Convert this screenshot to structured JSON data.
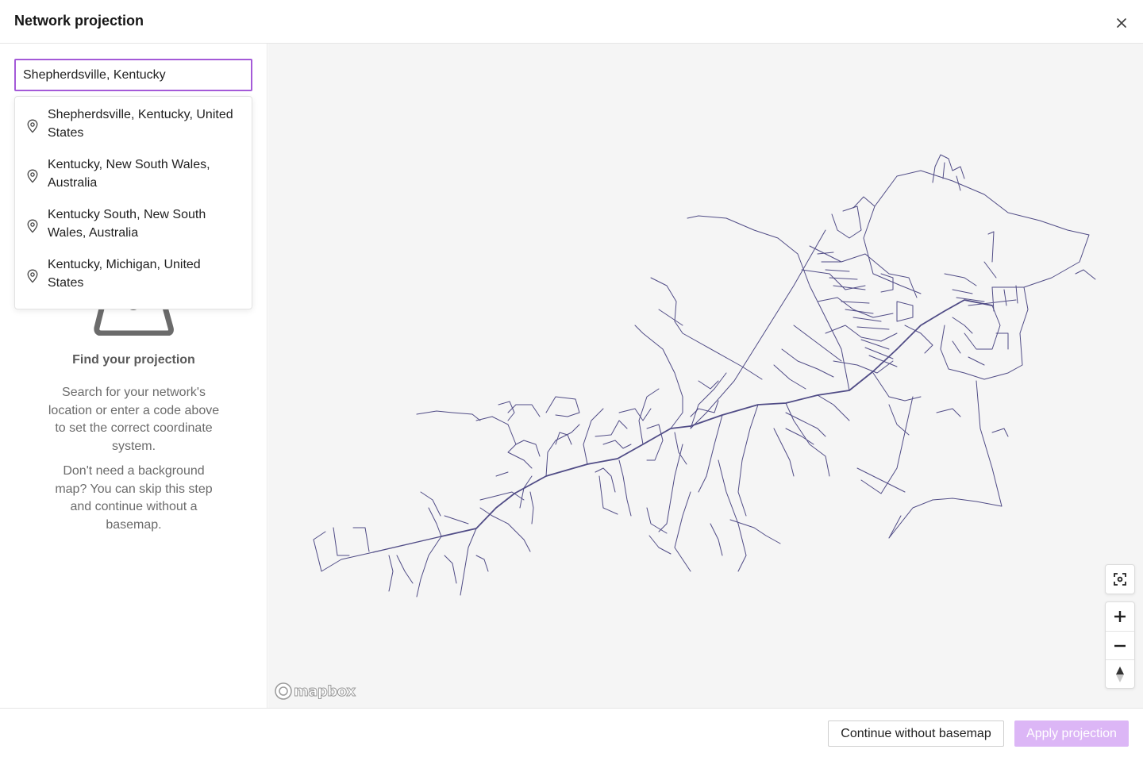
{
  "header": {
    "title": "Network projection",
    "close_icon": "close-icon"
  },
  "search": {
    "value": "Shepherdsville, Kentucky",
    "placeholder": "Search location or code"
  },
  "suggestions": [
    {
      "label": "Shepherdsville, Kentucky, United States",
      "icon": "map-pin-icon"
    },
    {
      "label": "Kentucky, New South Wales, Australia",
      "icon": "map-pin-icon"
    },
    {
      "label": "Kentucky South, New South Wales, Australia",
      "icon": "map-pin-icon"
    },
    {
      "label": "Kentucky, Michigan, United States",
      "icon": "map-pin-icon"
    }
  ],
  "empty_state": {
    "title": "Find your projection",
    "description": "Search for your network's location or enter a code above to set the correct coordinate system.",
    "skip_text": "Don't need a background map? You can skip this step and continue without a basemap."
  },
  "map": {
    "attribution": "mapbox",
    "network_color": "#3f3a7a",
    "background": "#f5f5f5",
    "controls": [
      "fit-to-network-icon",
      "zoom-in-icon",
      "zoom-out-icon",
      "compass-icon"
    ]
  },
  "footer": {
    "continue_label": "Continue without basemap",
    "apply_label": "Apply projection"
  },
  "colors": {
    "accent": "#a45ad8",
    "apply_disabled": "#dcb6f6"
  }
}
